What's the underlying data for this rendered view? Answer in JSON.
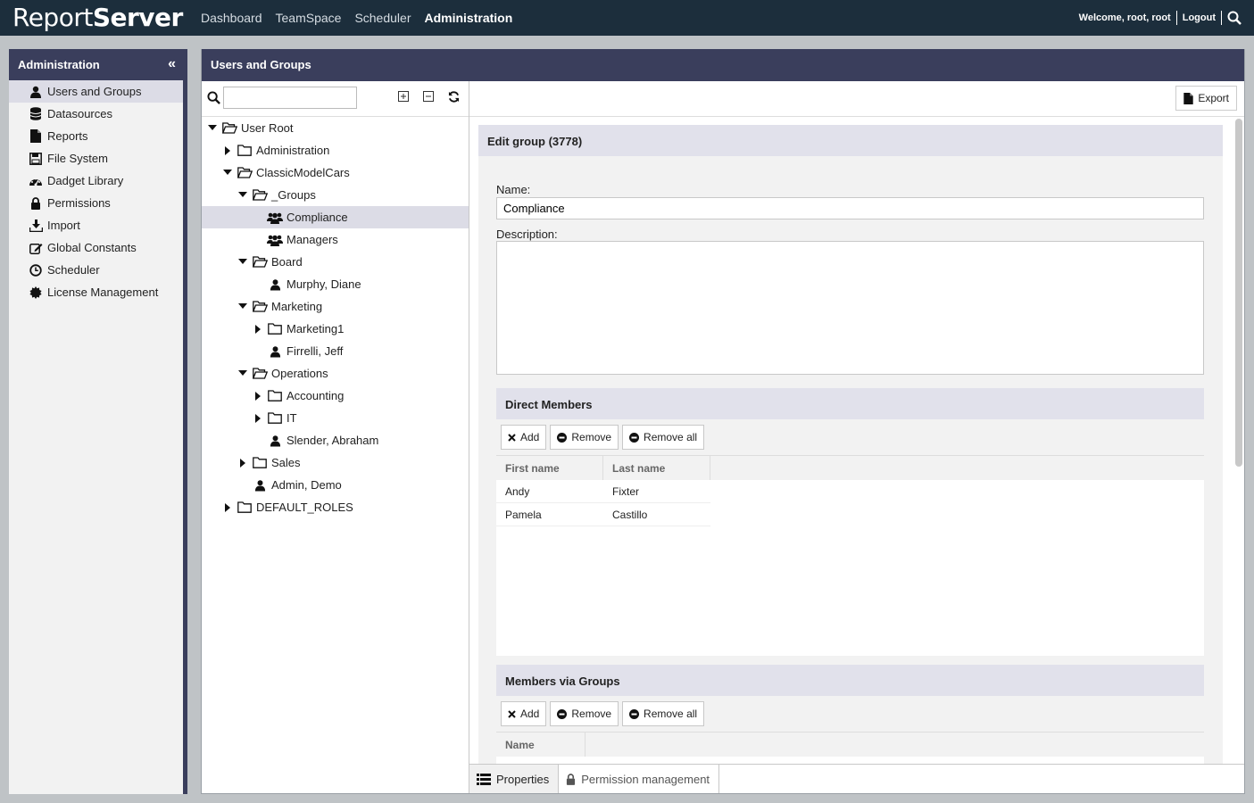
{
  "app": {
    "logo_main": "Report",
    "logo_bold": "Server"
  },
  "nav": [
    "Dashboard",
    "TeamSpace",
    "Scheduler",
    "Administration"
  ],
  "topright": {
    "welcome": "Welcome, root, root",
    "logout": "Logout"
  },
  "admin": {
    "title": "Administration",
    "items": [
      {
        "label": "Users and Groups",
        "icon": "user-icon"
      },
      {
        "label": "Datasources",
        "icon": "database-icon"
      },
      {
        "label": "Reports",
        "icon": "file-icon"
      },
      {
        "label": "File System",
        "icon": "floppy-icon"
      },
      {
        "label": "Dadget Library",
        "icon": "dashboard-icon"
      },
      {
        "label": "Permissions",
        "icon": "lock-icon"
      },
      {
        "label": "Import",
        "icon": "download-icon"
      },
      {
        "label": "Global Constants",
        "icon": "edit-icon"
      },
      {
        "label": "Scheduler",
        "icon": "clock-icon"
      },
      {
        "label": "License Management",
        "icon": "certificate-icon"
      }
    ]
  },
  "main": {
    "title": "Users and Groups"
  },
  "tree": [
    {
      "label": "User Root",
      "level": 0,
      "type": "folder-open",
      "toggle": "open"
    },
    {
      "label": "Administration",
      "level": 1,
      "type": "folder",
      "toggle": "closed"
    },
    {
      "label": "ClassicModelCars",
      "level": 1,
      "type": "folder-open",
      "toggle": "open"
    },
    {
      "label": "_Groups",
      "level": 2,
      "type": "folder-open",
      "toggle": "open"
    },
    {
      "label": "Compliance",
      "level": 3,
      "type": "group",
      "toggle": "none",
      "selected": true
    },
    {
      "label": "Managers",
      "level": 3,
      "type": "group",
      "toggle": "none"
    },
    {
      "label": "Board",
      "level": 2,
      "type": "folder-open",
      "toggle": "open"
    },
    {
      "label": "Murphy, Diane",
      "level": 3,
      "type": "user",
      "toggle": "none"
    },
    {
      "label": "Marketing",
      "level": 2,
      "type": "folder-open",
      "toggle": "open"
    },
    {
      "label": "Marketing1",
      "level": 3,
      "type": "folder",
      "toggle": "closed"
    },
    {
      "label": "Firrelli, Jeff",
      "level": 3,
      "type": "user",
      "toggle": "none"
    },
    {
      "label": "Operations",
      "level": 2,
      "type": "folder-open",
      "toggle": "open"
    },
    {
      "label": "Accounting",
      "level": 3,
      "type": "folder",
      "toggle": "closed"
    },
    {
      "label": "IT",
      "level": 3,
      "type": "folder",
      "toggle": "closed"
    },
    {
      "label": "Slender, Abraham",
      "level": 3,
      "type": "user",
      "toggle": "none"
    },
    {
      "label": "Sales",
      "level": 2,
      "type": "folder",
      "toggle": "closed"
    },
    {
      "label": "Admin, Demo",
      "level": 2,
      "type": "user",
      "toggle": "none"
    },
    {
      "label": "DEFAULT_ROLES",
      "level": 1,
      "type": "folder",
      "toggle": "closed"
    }
  ],
  "detail": {
    "export_label": "Export",
    "form_title": "Edit group (3778)",
    "name_label": "Name:",
    "name_value": "Compliance",
    "description_label": "Description:",
    "description_value": "",
    "direct_members": {
      "title": "Direct Members",
      "buttons": [
        "Add",
        "Remove",
        "Remove all"
      ],
      "columns": [
        "First name",
        "Last name"
      ],
      "rows": [
        [
          "Andy",
          "Fixter"
        ],
        [
          "Pamela",
          "Castillo"
        ]
      ]
    },
    "members_via_groups": {
      "title": "Members via Groups",
      "buttons": [
        "Add",
        "Remove",
        "Remove all"
      ],
      "columns": [
        "Name"
      ]
    }
  },
  "tabs": [
    "Properties",
    "Permission management"
  ]
}
